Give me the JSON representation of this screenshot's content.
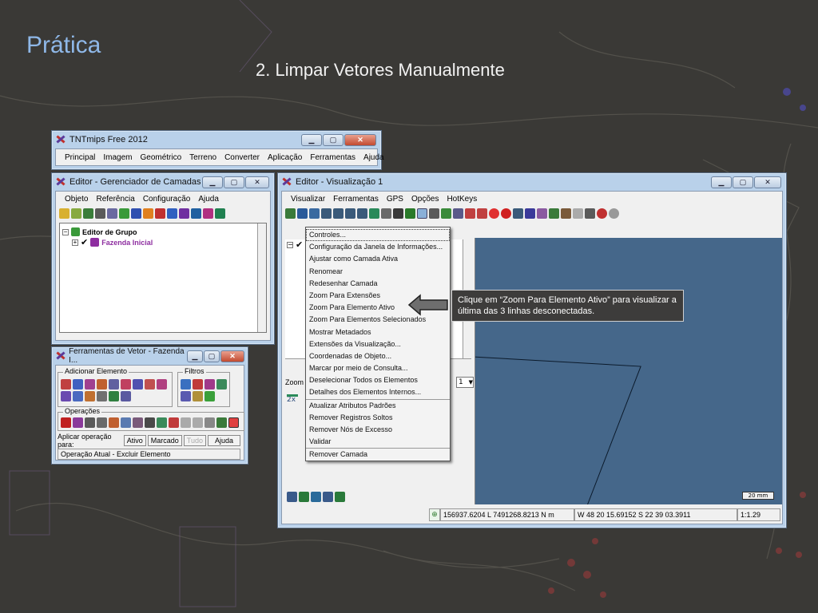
{
  "slide": {
    "title": "Prática",
    "subtitle": "2. Limpar Vetores Manualmente"
  },
  "main_window": {
    "title": "TNTmips Free 2012",
    "menu": [
      "Principal",
      "Imagem",
      "Geométrico",
      "Terreno",
      "Converter",
      "Aplicação",
      "Ferramentas",
      "Ajuda"
    ]
  },
  "layer_manager": {
    "title": "Editor - Gerenciador de Camadas",
    "menu": [
      "Objeto",
      "Referência",
      "Configuração",
      "Ajuda"
    ],
    "tree": {
      "group": "Editor de Grupo",
      "layer": "Fazenda Inicial"
    }
  },
  "vector_tools": {
    "title": "Ferramentas de Vetor - Fazenda I...",
    "add_element_label": "Adicionar Elemento",
    "filters_label": "Filtros",
    "operations_label": "Operações",
    "apply_label": "Aplicar operação para:",
    "btn_active": "Ativo",
    "btn_marked": "Marcado",
    "btn_all": "Tudo",
    "btn_help": "Ajuda",
    "current_operation": "Operação Atual - Excluir Elemento"
  },
  "viz_window": {
    "title": "Editor - Visualização 1",
    "menu": [
      "Visualizar",
      "Ferramentas",
      "GPS",
      "Opções",
      "HotKeys"
    ],
    "zoom_label": "Zoom",
    "zoom_value": "1",
    "zoom_2x": "2x",
    "scale_bar": "20 mm",
    "status": {
      "coords": "156937.6204 L  7491268.8213 N m",
      "geo": "W 48 20 15.69152  S 22 39 03.3911",
      "scale": "1:1.29"
    }
  },
  "context_menu": {
    "items_group1": [
      "Controles...",
      "Configuração da Janela de Informações...",
      "Ajustar como Camada Ativa",
      "Renomear",
      "Redesenhar Camada",
      "Zoom Para Extensões",
      "Zoom Para Elemento Ativo",
      "Zoom Para Elementos Selecionados",
      "Mostrar Metadados",
      "Extensões da Visualização...",
      "Coordenadas de Objeto...",
      "Marcar por meio de Consulta...",
      "Deselecionar Todos os Elementos",
      "Detalhes dos Elementos Internos..."
    ],
    "items_group2": [
      "Atualizar Atributos Padrões",
      "Remover Registros Soltos",
      "Remover Nós de Excesso",
      "Validar"
    ],
    "items_group3": [
      "Remover Camada"
    ]
  },
  "callout": {
    "text": "Clique em “Zoom Para Elemento Ativo” para visualizar a última das 3 linhas desconectadas."
  },
  "colors": {
    "title": "#8fb8e8",
    "canvas": "#45678a",
    "window_frame": "#b9d1ea"
  }
}
